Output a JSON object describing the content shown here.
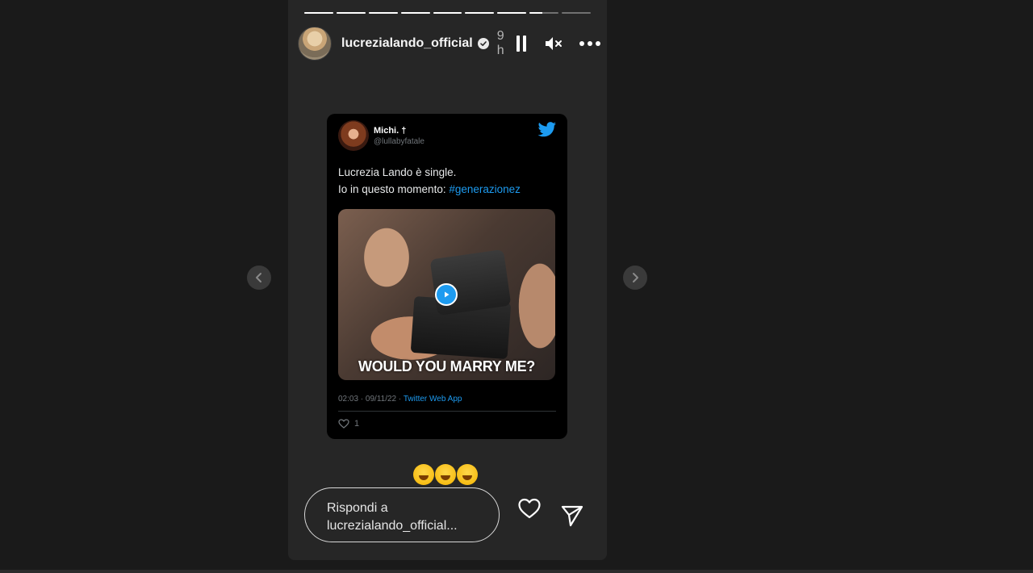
{
  "story": {
    "segments": [
      1,
      1,
      1,
      1,
      1,
      1,
      1,
      0.45,
      0
    ],
    "username": "lucrezialando_official",
    "time": "9 h",
    "icons": {
      "verified": "verified-badge-icon",
      "pause": "pause-icon",
      "mute": "volume-muted-icon",
      "more": "more-options-icon",
      "heart": "heart-icon",
      "send": "send-icon",
      "prev": "chevron-left-icon",
      "next": "chevron-right-icon"
    }
  },
  "tweet": {
    "name": "Michi. †",
    "handle": "@lullabyfatale",
    "text_line1": "Lucrezia Lando è single.",
    "text_line2_prefix": "Io in questo momento: ",
    "hashtag": "#generazionez",
    "media_caption": "WOULD YOU MARRY ME?",
    "meta_datetime": "02:03 · 09/11/22 · ",
    "meta_app": "Twitter Web App",
    "likes": "1",
    "brand_color": "#1d9bf0"
  },
  "reply": {
    "line1": "Rispondi a",
    "line2": "lucrezialando_official..."
  }
}
